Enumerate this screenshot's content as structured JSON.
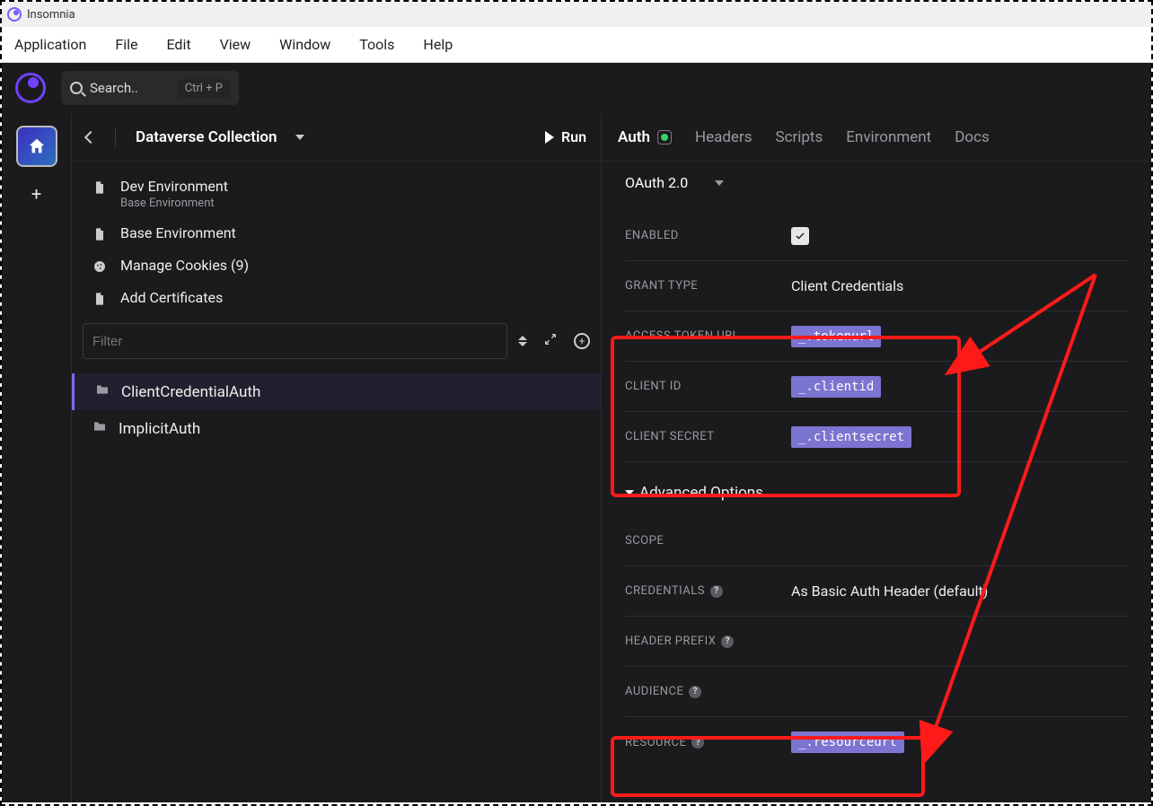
{
  "window": {
    "title": "Insomnia"
  },
  "menu": {
    "items": [
      "Application",
      "File",
      "Edit",
      "View",
      "Window",
      "Tools",
      "Help"
    ]
  },
  "search": {
    "placeholder": "Search..",
    "shortcut": "Ctrl + P"
  },
  "collection": {
    "name": "Dataverse Collection",
    "run": "Run"
  },
  "env": {
    "dev_label": "Dev Environment",
    "dev_sub": "Base Environment",
    "base_label": "Base Environment",
    "cookies_label": "Manage Cookies (9)",
    "certs_label": "Add Certificates"
  },
  "filter": {
    "placeholder": "Filter"
  },
  "tree": {
    "item1": "ClientCredentialAuth",
    "item2": "ImplicitAuth"
  },
  "tabs": {
    "auth": "Auth",
    "headers": "Headers",
    "scripts": "Scripts",
    "environment": "Environment",
    "docs": "Docs"
  },
  "auth": {
    "type": "OAuth 2.0",
    "enabled_label": "ENABLED",
    "grant_type_label": "GRANT TYPE",
    "grant_type_value": "Client Credentials",
    "access_token_url_label": "ACCESS TOKEN URL",
    "access_token_url_value": "_.tokenurl",
    "client_id_label": "CLIENT ID",
    "client_id_value": "_.clientid",
    "client_secret_label": "CLIENT SECRET",
    "client_secret_value": "_.clientsecret",
    "advanced_label": "Advanced Options",
    "scope_label": "SCOPE",
    "credentials_label": "CREDENTIALS",
    "credentials_value": "As Basic Auth Header (default)",
    "header_prefix_label": "HEADER PREFIX",
    "audience_label": "AUDIENCE",
    "resource_label": "RESOURCE",
    "resource_value": "_.resourceurl"
  }
}
